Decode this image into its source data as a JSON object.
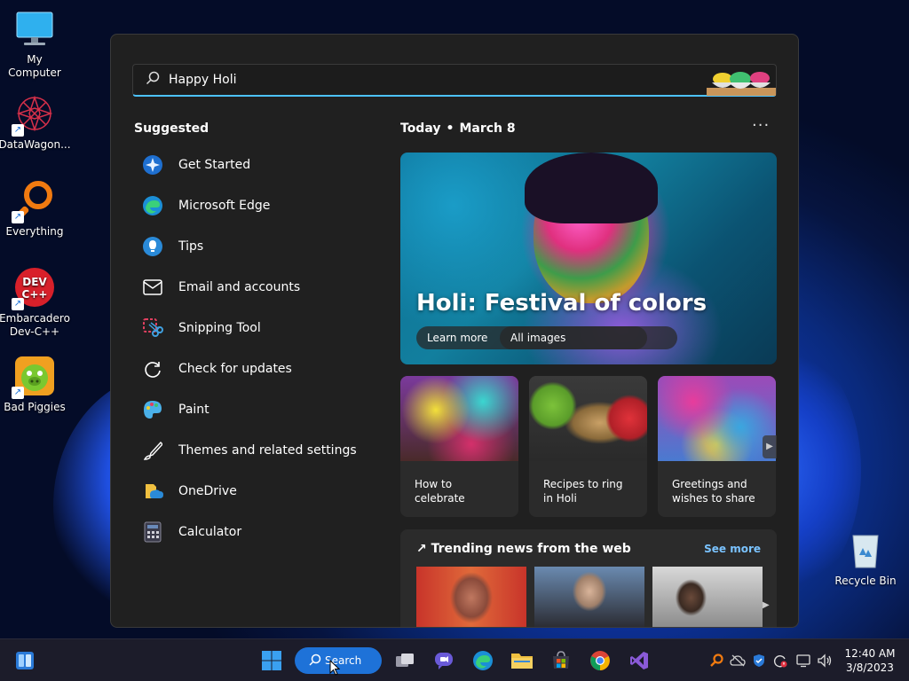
{
  "desktop": {
    "icons": [
      {
        "label": "My Computer"
      },
      {
        "label": "DataWagon..."
      },
      {
        "label": "Everything"
      },
      {
        "label": "Embarcadero Dev-C++"
      },
      {
        "label": "Bad Piggies"
      },
      {
        "label": "Recycle Bin"
      }
    ]
  },
  "search": {
    "query": "Happy Holi"
  },
  "suggested": {
    "title": "Suggested",
    "items": [
      {
        "label": "Get Started",
        "icon": "get-started-icon"
      },
      {
        "label": "Microsoft Edge",
        "icon": "edge-icon"
      },
      {
        "label": "Tips",
        "icon": "tips-icon"
      },
      {
        "label": "Email and accounts",
        "icon": "mail-icon"
      },
      {
        "label": "Snipping Tool",
        "icon": "snipping-tool-icon"
      },
      {
        "label": "Check for updates",
        "icon": "refresh-icon"
      },
      {
        "label": "Paint",
        "icon": "paint-icon"
      },
      {
        "label": "Themes and related settings",
        "icon": "brush-icon"
      },
      {
        "label": "OneDrive",
        "icon": "onedrive-icon"
      },
      {
        "label": "Calculator",
        "icon": "calculator-icon"
      }
    ]
  },
  "highlights": {
    "today_label": "Today",
    "date_label": "March 8",
    "hero": {
      "title": "Holi: Festival of colors",
      "learn_more": "Learn more",
      "all_images": "All images"
    },
    "cards": [
      {
        "caption": "How to celebrate"
      },
      {
        "caption": "Recipes to ring in Holi"
      },
      {
        "caption": "Greetings and wishes to share"
      }
    ],
    "trending": {
      "title": "Trending news from the web",
      "see_more": "See more"
    }
  },
  "taskbar": {
    "search_label": "Search",
    "time": "12:40 AM",
    "date": "3/8/2023"
  },
  "colors": {
    "accent": "#4cc2ff",
    "search_pill": "#1e72d8",
    "panel_bg": "#202020"
  }
}
